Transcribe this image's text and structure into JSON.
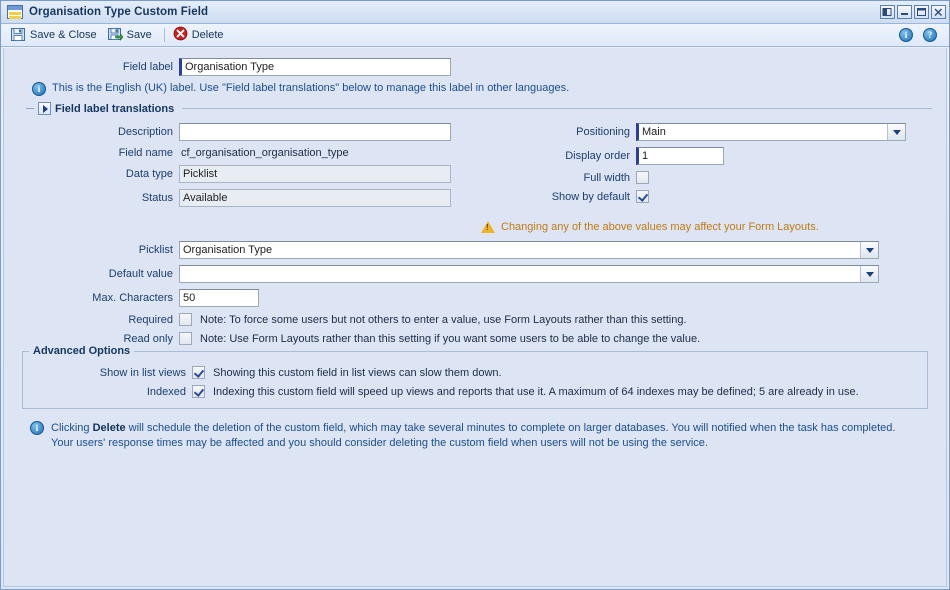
{
  "window": {
    "title": "Organisation Type Custom Field",
    "icon": "form-window-icon",
    "controls": [
      {
        "name": "pin-button",
        "label": "Pin"
      },
      {
        "name": "minimize-button",
        "label": "Minimize"
      },
      {
        "name": "maximize-button",
        "label": "Maximize"
      },
      {
        "name": "close-button",
        "label": "Close"
      }
    ]
  },
  "toolbar": {
    "save_close_label": "Save & Close",
    "save_label": "Save",
    "delete_label": "Delete",
    "info_icon_label": "i",
    "help_icon_label": "?"
  },
  "field_label": {
    "label": "Field label",
    "value": "Organisation Type",
    "info": "This is the English (UK) label. Use \"Field label translations\" below to manage this label in other languages."
  },
  "translations_section": {
    "title": "Field label translations",
    "expanded": false
  },
  "left_column": [
    {
      "label": "Description",
      "value": "",
      "type": "input",
      "required": false
    },
    {
      "label": "Field name",
      "value": "cf_organisation_organisation_type",
      "type": "text",
      "required": false
    },
    {
      "label": "Data type",
      "value": "Picklist",
      "type": "readonly",
      "required": false
    },
    {
      "label": "Status",
      "value": "Available",
      "type": "readonly",
      "required": false
    }
  ],
  "right_column": [
    {
      "label": "Positioning",
      "value": "Main",
      "type": "select",
      "required": true
    },
    {
      "label": "Display order",
      "value": "1",
      "type": "input",
      "required": true
    },
    {
      "label": "Full width",
      "value": "",
      "type": "checkbox",
      "checked": false
    },
    {
      "label": "Show by default",
      "value": "",
      "type": "checkbox",
      "checked": true
    }
  ],
  "warning": {
    "text": "Changing any of the above values may affect your Form Layouts.",
    "color": "#c07b12"
  },
  "picklist_rows": [
    {
      "label": "Picklist",
      "value": "Organisation Type",
      "type": "select"
    },
    {
      "label": "Default value",
      "value": "",
      "type": "select"
    },
    {
      "label": "Max. Characters",
      "value": "50",
      "type": "input"
    }
  ],
  "toggles": [
    {
      "label": "Required",
      "checked": false,
      "note": "Note: To force some users but not others to enter a value, use Form Layouts rather than this setting."
    },
    {
      "label": "Read only",
      "checked": false,
      "note": "Note: Use Form Layouts rather than this setting if you want some users to be able to change the value."
    }
  ],
  "advanced": {
    "legend": "Advanced Options",
    "options": [
      {
        "label": "Show in list views",
        "checked": true,
        "note": "Showing this custom field in list views can slow them down."
      },
      {
        "label": "Indexed",
        "checked": true,
        "note": "Indexing this custom field will speed up views and reports that use it. A maximum of 64 indexes may be defined; 5 are already in use."
      }
    ]
  },
  "footer_info": {
    "line1_pre": "Clicking ",
    "line1_bold": "Delete",
    "line1_post": " will schedule the deletion of the custom field, which may take several minutes to complete on larger databases. You will notified when the task has completed.",
    "line2": "Your users' response times may be affected and you should consider deleting the custom field when users will not be using the service."
  },
  "colors": {
    "background": "#dde5f5",
    "title_text": "#14365f",
    "info_text": "#1b4e8c",
    "warning_text": "#c07b12",
    "required_accent": "#2b3fa0"
  }
}
